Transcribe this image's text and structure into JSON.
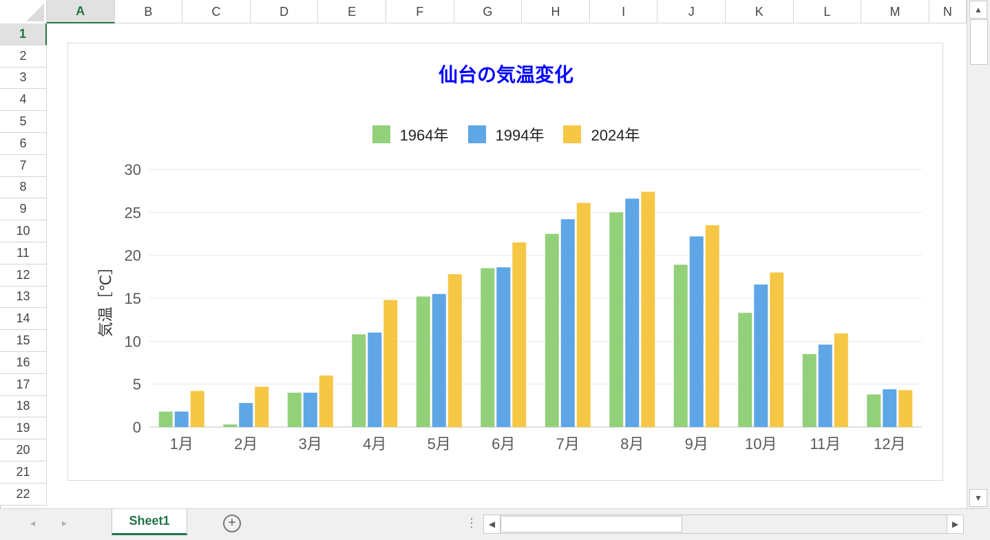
{
  "spreadsheet": {
    "corner": "",
    "columns": [
      "A",
      "B",
      "C",
      "D",
      "E",
      "F",
      "G",
      "H",
      "I",
      "J",
      "K",
      "L",
      "M",
      "N"
    ],
    "selected_column": "A",
    "rows": [
      "1",
      "2",
      "3",
      "4",
      "5",
      "6",
      "7",
      "8",
      "9",
      "10",
      "11",
      "12",
      "13",
      "14",
      "15",
      "16",
      "17",
      "18",
      "19",
      "20",
      "21",
      "22"
    ],
    "selected_row": "1"
  },
  "sheet_tabs": {
    "active": "Sheet1",
    "add_icon": "plus-circle-icon"
  },
  "scrollbars": {
    "up_icon": "▲",
    "down_icon": "▼",
    "left_icon": "◀",
    "right_icon": "▶"
  },
  "colors": {
    "accent": "#217346",
    "title": "#0000ff",
    "s1964": "#92d07a",
    "s1994": "#5ea6e6",
    "s2024": "#f5c745",
    "grid": "#e8e8e8",
    "axis_text": "#595959"
  },
  "chart_data": {
    "type": "bar",
    "title": "仙台の気温変化",
    "ylabel": "気温［℃］",
    "xlabel": "",
    "categories": [
      "1月",
      "2月",
      "3月",
      "4月",
      "5月",
      "6月",
      "7月",
      "8月",
      "9月",
      "10月",
      "11月",
      "12月"
    ],
    "series": [
      {
        "name": "1964年",
        "color": "#92d07a",
        "values": [
          1.8,
          0.3,
          4.0,
          10.8,
          15.2,
          18.5,
          22.5,
          25.0,
          18.9,
          13.3,
          8.5,
          3.8
        ]
      },
      {
        "name": "1994年",
        "color": "#5ea6e6",
        "values": [
          1.8,
          2.8,
          4.0,
          11.0,
          15.5,
          18.6,
          24.2,
          26.6,
          22.2,
          16.6,
          9.6,
          4.4
        ]
      },
      {
        "name": "2024年",
        "color": "#f5c745",
        "values": [
          4.2,
          4.7,
          6.0,
          14.8,
          17.8,
          21.5,
          26.1,
          27.4,
          23.5,
          18.0,
          10.9,
          4.3
        ]
      }
    ],
    "ylim": [
      0,
      30
    ],
    "yticks": [
      "0",
      "5",
      "10",
      "15",
      "20",
      "25",
      "30"
    ],
    "grid": true,
    "legend_position": "top"
  }
}
